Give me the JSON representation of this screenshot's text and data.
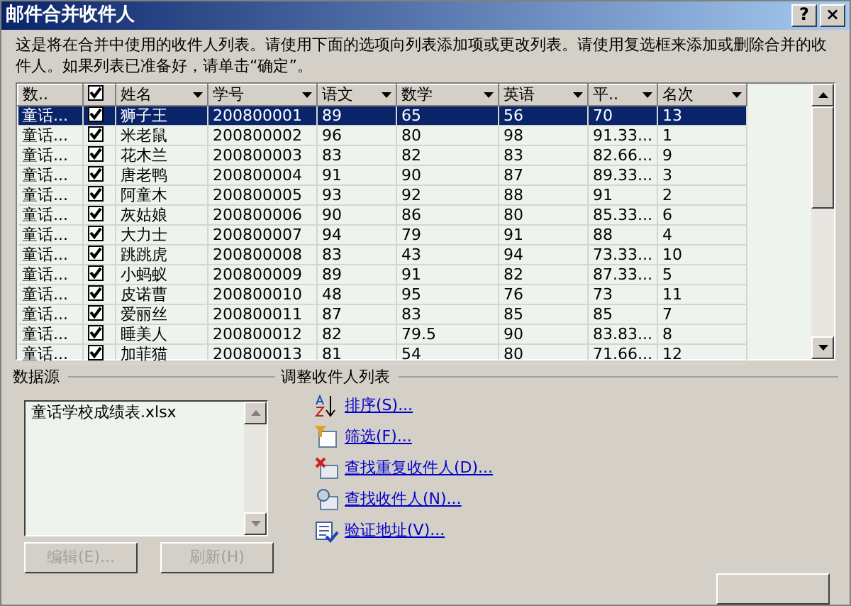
{
  "window": {
    "title": "邮件合并收件人",
    "help_button": "?",
    "close_button": "×"
  },
  "description": "这是将在合并中使用的收件人列表。请使用下面的选项向列表添加项或更改列表。请使用复选框来添加或删除合并的收件人。如果列表已准备好，请单击“确定”。",
  "table": {
    "columns": [
      {
        "label": "数.."
      },
      {
        "kind": "check",
        "checked": true
      },
      {
        "label": "姓名"
      },
      {
        "label": "学号"
      },
      {
        "label": "语文"
      },
      {
        "label": "数学"
      },
      {
        "label": "英语"
      },
      {
        "label": "平.."
      },
      {
        "label": "名次"
      }
    ],
    "rows": [
      {
        "selected": true,
        "checked": true,
        "cells": [
          "童话...",
          "",
          "狮子王",
          "200800001",
          "89",
          "65",
          "56",
          "70",
          "13"
        ]
      },
      {
        "selected": false,
        "checked": true,
        "cells": [
          "童话...",
          "",
          "米老鼠",
          "200800002",
          "96",
          "80",
          "98",
          "91.33...",
          "1"
        ]
      },
      {
        "selected": false,
        "checked": true,
        "cells": [
          "童话...",
          "",
          "花木兰",
          "200800003",
          "83",
          "82",
          "83",
          "82.66...",
          "9"
        ]
      },
      {
        "selected": false,
        "checked": true,
        "cells": [
          "童话...",
          "",
          "唐老鸭",
          "200800004",
          "91",
          "90",
          "87",
          "89.33...",
          "3"
        ]
      },
      {
        "selected": false,
        "checked": true,
        "cells": [
          "童话...",
          "",
          "阿童木",
          "200800005",
          "93",
          "92",
          "88",
          "91",
          "2"
        ]
      },
      {
        "selected": false,
        "checked": true,
        "cells": [
          "童话...",
          "",
          "灰姑娘",
          "200800006",
          "90",
          "86",
          "80",
          "85.33...",
          "6"
        ]
      },
      {
        "selected": false,
        "checked": true,
        "cells": [
          "童话...",
          "",
          "大力士",
          "200800007",
          "94",
          "79",
          "91",
          "88",
          "4"
        ]
      },
      {
        "selected": false,
        "checked": true,
        "cells": [
          "童话...",
          "",
          "跳跳虎",
          "200800008",
          "83",
          "43",
          "94",
          "73.33...",
          "10"
        ]
      },
      {
        "selected": false,
        "checked": true,
        "cells": [
          "童话...",
          "",
          "小蚂蚁",
          "200800009",
          "89",
          "91",
          "82",
          "87.33...",
          "5"
        ]
      },
      {
        "selected": false,
        "checked": true,
        "cells": [
          "童话...",
          "",
          "皮诺曹",
          "200800010",
          "48",
          "95",
          "76",
          "73",
          "11"
        ]
      },
      {
        "selected": false,
        "checked": true,
        "cells": [
          "童话...",
          "",
          "爱丽丝",
          "200800011",
          "87",
          "83",
          "85",
          "85",
          "7"
        ]
      },
      {
        "selected": false,
        "checked": true,
        "cells": [
          "童话...",
          "",
          "睡美人",
          "200800012",
          "82",
          "79.5",
          "90",
          "83.83...",
          "8"
        ]
      },
      {
        "selected": false,
        "checked": true,
        "cells": [
          "童话...",
          "",
          "加菲猫",
          "200800013",
          "81",
          "54",
          "80",
          "71.66...",
          "12"
        ]
      }
    ]
  },
  "data_source": {
    "title": "数据源",
    "items": [
      "童话学校成绩表.xlsx"
    ],
    "buttons": [
      {
        "label": "编辑(E)...",
        "disabled": true
      },
      {
        "label": "刷新(H)",
        "disabled": true
      }
    ]
  },
  "adjust": {
    "title": "调整收件人列表",
    "links": [
      {
        "kind": "sort",
        "label": "排序(S)..."
      },
      {
        "kind": "filter",
        "label": "筛选(F)..."
      },
      {
        "kind": "duplicates",
        "label": "查找重复收件人(D)..."
      },
      {
        "kind": "find",
        "label": "查找收件人(N)..."
      },
      {
        "kind": "validate",
        "label": "验证地址(V)..."
      }
    ]
  }
}
